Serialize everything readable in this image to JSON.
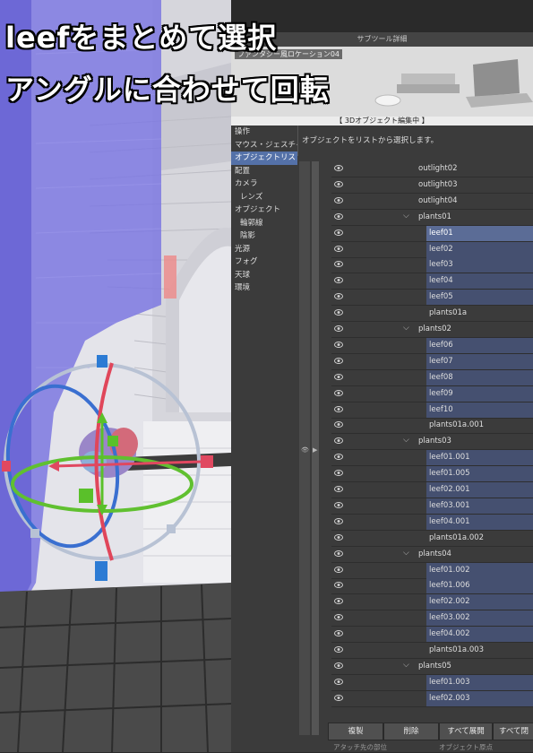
{
  "caption": {
    "line1": "leefをまとめて選択",
    "line2": "アングルに合わせて回転"
  },
  "panel": {
    "title": "サブツール詳細",
    "preview_label": "ファンタジー風ロケーション04",
    "mode": "【 3Dオブジェクト編集中 】",
    "instruction": "オブジェクトをリストから選択します。",
    "menu": [
      {
        "label": "操作",
        "sub": false,
        "active": false
      },
      {
        "label": "マウス・ジェスチャー",
        "sub": false,
        "active": false
      },
      {
        "label": "オブジェクトリスト",
        "sub": false,
        "active": true
      },
      {
        "label": "配置",
        "sub": false,
        "active": false
      },
      {
        "label": "カメラ",
        "sub": false,
        "active": false
      },
      {
        "label": "レンズ",
        "sub": true,
        "active": false
      },
      {
        "label": "オブジェクト",
        "sub": false,
        "active": false
      },
      {
        "label": "輪郭線",
        "sub": true,
        "active": false
      },
      {
        "label": "陰影",
        "sub": true,
        "active": false
      },
      {
        "label": "光源",
        "sub": false,
        "active": false
      },
      {
        "label": "フォグ",
        "sub": false,
        "active": false
      },
      {
        "label": "天球",
        "sub": false,
        "active": false
      },
      {
        "label": "環境",
        "sub": false,
        "active": false
      }
    ],
    "tree": [
      {
        "name": "outlight02",
        "level": 1,
        "group": false,
        "state": "normal"
      },
      {
        "name": "outlight03",
        "level": 1,
        "group": false,
        "state": "normal"
      },
      {
        "name": "outlight04",
        "level": 1,
        "group": false,
        "state": "normal"
      },
      {
        "name": "plants01",
        "level": 1,
        "group": true,
        "state": "normal"
      },
      {
        "name": "leef01",
        "level": 2,
        "group": false,
        "state": "active"
      },
      {
        "name": "leef02",
        "level": 2,
        "group": false,
        "state": "selected"
      },
      {
        "name": "leef03",
        "level": 2,
        "group": false,
        "state": "selected"
      },
      {
        "name": "leef04",
        "level": 2,
        "group": false,
        "state": "selected"
      },
      {
        "name": "leef05",
        "level": 2,
        "group": false,
        "state": "selected"
      },
      {
        "name": "plants01a",
        "level": 2,
        "group": false,
        "state": "normal"
      },
      {
        "name": "plants02",
        "level": 1,
        "group": true,
        "state": "normal"
      },
      {
        "name": "leef06",
        "level": 2,
        "group": false,
        "state": "selected"
      },
      {
        "name": "leef07",
        "level": 2,
        "group": false,
        "state": "selected"
      },
      {
        "name": "leef08",
        "level": 2,
        "group": false,
        "state": "selected"
      },
      {
        "name": "leef09",
        "level": 2,
        "group": false,
        "state": "selected"
      },
      {
        "name": "leef10",
        "level": 2,
        "group": false,
        "state": "selected"
      },
      {
        "name": "plants01a.001",
        "level": 2,
        "group": false,
        "state": "normal"
      },
      {
        "name": "plants03",
        "level": 1,
        "group": true,
        "state": "normal"
      },
      {
        "name": "leef01.001",
        "level": 2,
        "group": false,
        "state": "selected"
      },
      {
        "name": "leef01.005",
        "level": 2,
        "group": false,
        "state": "selected"
      },
      {
        "name": "leef02.001",
        "level": 2,
        "group": false,
        "state": "selected"
      },
      {
        "name": "leef03.001",
        "level": 2,
        "group": false,
        "state": "selected"
      },
      {
        "name": "leef04.001",
        "level": 2,
        "group": false,
        "state": "selected"
      },
      {
        "name": "plants01a.002",
        "level": 2,
        "group": false,
        "state": "normal"
      },
      {
        "name": "plants04",
        "level": 1,
        "group": true,
        "state": "normal"
      },
      {
        "name": "leef01.002",
        "level": 2,
        "group": false,
        "state": "selected"
      },
      {
        "name": "leef01.006",
        "level": 2,
        "group": false,
        "state": "selected"
      },
      {
        "name": "leef02.002",
        "level": 2,
        "group": false,
        "state": "selected"
      },
      {
        "name": "leef03.002",
        "level": 2,
        "group": false,
        "state": "selected"
      },
      {
        "name": "leef04.002",
        "level": 2,
        "group": false,
        "state": "selected"
      },
      {
        "name": "plants01a.003",
        "level": 2,
        "group": false,
        "state": "normal"
      },
      {
        "name": "plants05",
        "level": 1,
        "group": true,
        "state": "normal"
      },
      {
        "name": "leef01.003",
        "level": 2,
        "group": false,
        "state": "selected"
      },
      {
        "name": "leef02.003",
        "level": 2,
        "group": false,
        "state": "selected"
      }
    ],
    "buttons": {
      "duplicate": "複製",
      "delete": "削除",
      "expand_all": "すべて展開",
      "collapse_all": "すべて閉"
    },
    "footer": {
      "attach": "アタッチ先の部位",
      "origin": "オブジェクト原点"
    }
  },
  "colors": {
    "selected_row": "#455070",
    "active_row": "#5b6c96",
    "menu_active": "#5471a8",
    "wall_tint": "#7d78e0"
  }
}
